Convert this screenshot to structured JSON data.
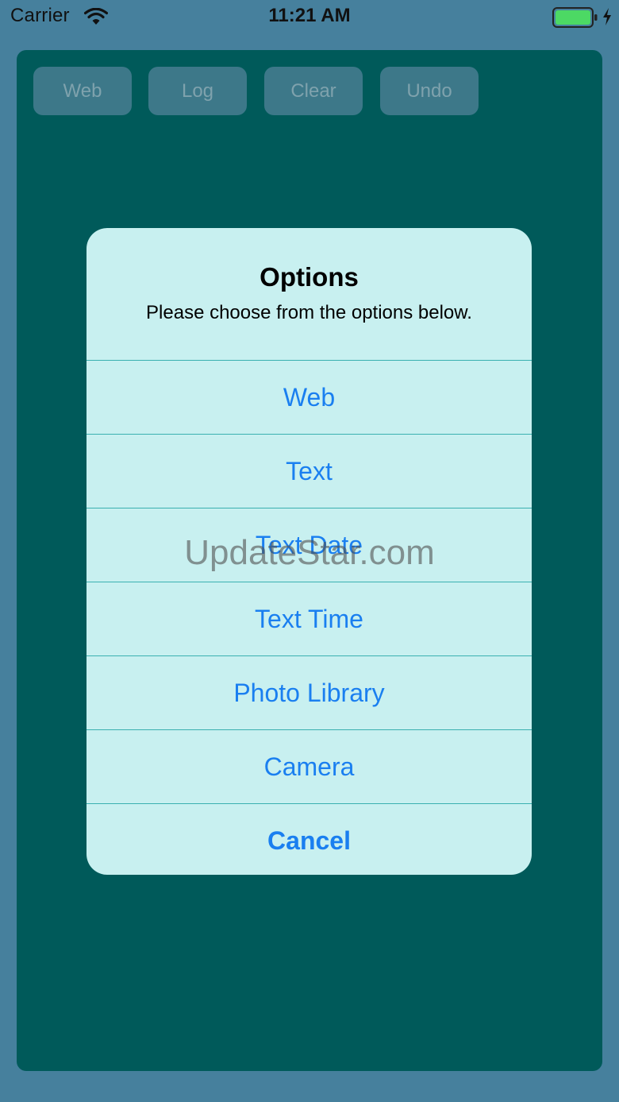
{
  "status_bar": {
    "carrier": "Carrier",
    "time": "11:21 AM",
    "wifi_icon": "wifi-icon",
    "battery_icon": "battery-icon",
    "charging_icon": "charging-bolt-icon",
    "battery_color": "#4cd964"
  },
  "toolbar": {
    "buttons": [
      {
        "label": "Web"
      },
      {
        "label": "Log"
      },
      {
        "label": "Clear"
      },
      {
        "label": "Undo"
      }
    ]
  },
  "alert": {
    "title": "Options",
    "message": "Please choose from the options below.",
    "actions": [
      {
        "label": "Web"
      },
      {
        "label": "Text"
      },
      {
        "label": "Text Date"
      },
      {
        "label": "Text Time"
      },
      {
        "label": "Photo Library"
      },
      {
        "label": "Camera"
      },
      {
        "label": "Cancel"
      }
    ]
  },
  "watermark": "UpdateStar.com",
  "colors": {
    "background": "#46809d",
    "panel": "#005a5a",
    "alert_background": "#c8f0f0",
    "action_text": "#1a7ff0"
  }
}
